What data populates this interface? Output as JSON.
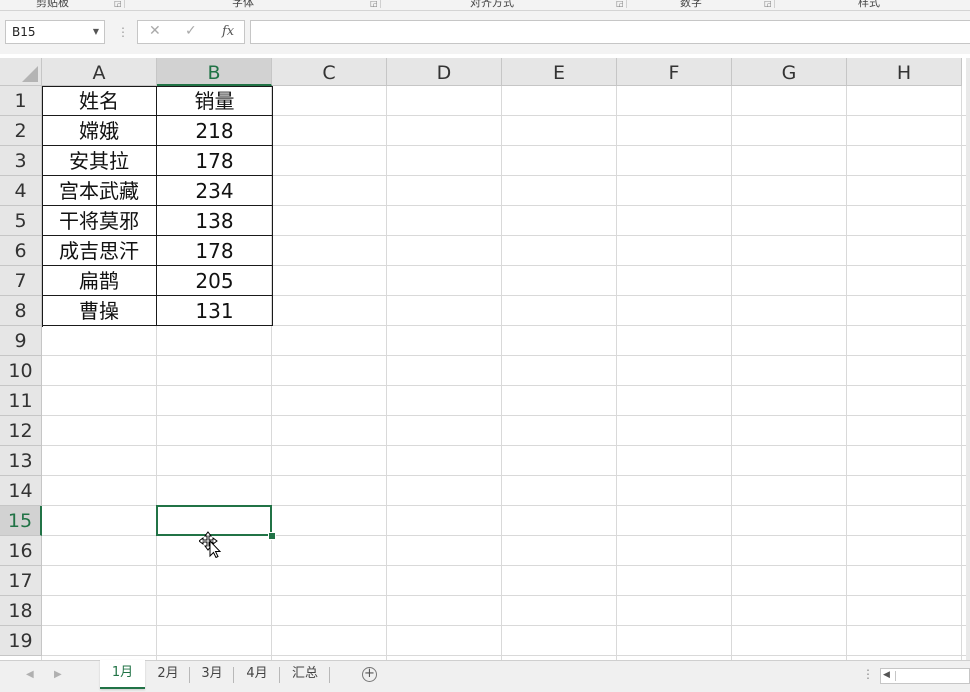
{
  "ribbon": {
    "groups": [
      "剪贴板",
      "字体",
      "对齐方式",
      "数字",
      "样式"
    ]
  },
  "formula_bar": {
    "name_box": "B15",
    "cancel_icon": "✕",
    "enter_icon": "✓",
    "fx_label": "fx",
    "content": ""
  },
  "columns": [
    "A",
    "B",
    "C",
    "D",
    "E",
    "F",
    "G",
    "H"
  ],
  "rows": [
    "1",
    "2",
    "3",
    "4",
    "5",
    "6",
    "7",
    "8",
    "9",
    "10",
    "11",
    "12",
    "13",
    "14",
    "15",
    "16",
    "17",
    "18",
    "19"
  ],
  "selected_cell": {
    "column": "B",
    "row": "15"
  },
  "table": {
    "header": [
      "姓名",
      "销量"
    ],
    "rows": [
      [
        "嫦娥",
        "218"
      ],
      [
        "安其拉",
        "178"
      ],
      [
        "宫本武藏",
        "234"
      ],
      [
        "干将莫邪",
        "138"
      ],
      [
        "成吉思汗",
        "178"
      ],
      [
        "扁鹊",
        "205"
      ],
      [
        "曹操",
        "131"
      ]
    ]
  },
  "sheet_tabs": [
    {
      "label": "1月",
      "active": true
    },
    {
      "label": "2月",
      "active": false
    },
    {
      "label": "3月",
      "active": false
    },
    {
      "label": "4月",
      "active": false
    },
    {
      "label": "汇总",
      "active": false
    }
  ],
  "icons": {
    "add_sheet": "plus-circle-icon",
    "scroll_left": "chevron-left-icon",
    "scroll_right": "chevron-right-icon",
    "cursor": "move-cursor-icon"
  },
  "colors": {
    "accent": "#217346",
    "header_bg": "#e6e6e6",
    "gridline": "#d9d9d9"
  }
}
